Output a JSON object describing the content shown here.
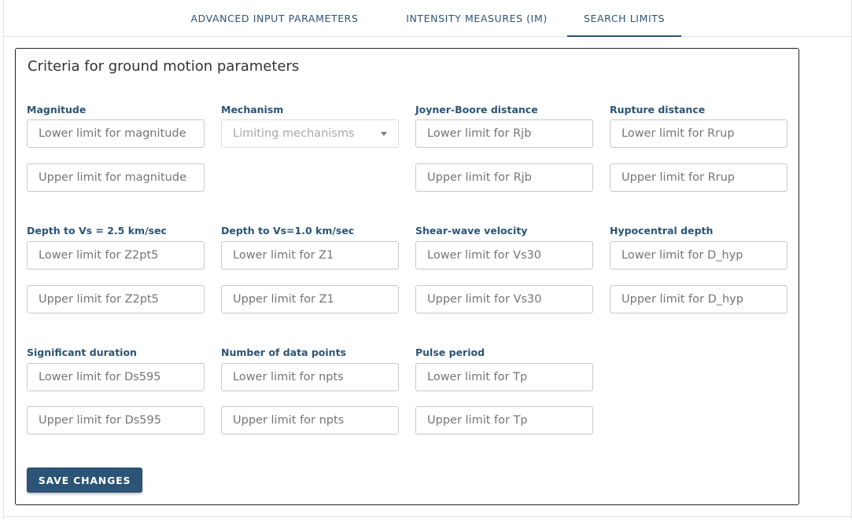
{
  "tabs": [
    {
      "label": "ADVANCED INPUT PARAMETERS",
      "active": false
    },
    {
      "label": "INTENSITY MEASURES (IM)",
      "active": false
    },
    {
      "label": "SEARCH LIMITS",
      "active": true
    }
  ],
  "card": {
    "title": "Criteria for ground motion parameters"
  },
  "fields": {
    "magnitude": {
      "label": "Magnitude",
      "lower": "Lower limit for magnitude",
      "upper": "Upper limit for magnitude"
    },
    "mechanism": {
      "label": "Mechanism",
      "placeholder": "Limiting mechanisms"
    },
    "rjb": {
      "label": "Joyner-Boore distance",
      "lower": "Lower limit for Rjb",
      "upper": "Upper limit for Rjb"
    },
    "rrup": {
      "label": "Rupture distance",
      "lower": "Lower limit for Rrup",
      "upper": "Upper limit for Rrup"
    },
    "z2pt5": {
      "label": "Depth to Vs = 2.5 km/sec",
      "lower": "Lower limit for Z2pt5",
      "upper": "Upper limit for Z2pt5"
    },
    "z1": {
      "label": "Depth to Vs=1.0 km/sec",
      "lower": "Lower limit for Z1",
      "upper": "Upper limit for Z1"
    },
    "vs30": {
      "label": "Shear-wave velocity",
      "lower": "Lower limit for Vs30",
      "upper": "Upper limit for Vs30"
    },
    "dhyp": {
      "label": "Hypocentral depth",
      "lower": "Lower limit for D_hyp",
      "upper": "Upper limit for D_hyp"
    },
    "ds595": {
      "label": "Significant duration",
      "lower": "Lower limit for Ds595",
      "upper": "Upper limit for Ds595"
    },
    "npts": {
      "label": "Number of data points",
      "lower": "Lower limit for npts",
      "upper": "Upper limit for npts"
    },
    "tp": {
      "label": "Pulse period",
      "lower": "Lower limit for Tp",
      "upper": "Upper limit for Tp"
    }
  },
  "actions": {
    "save_label": "SAVE CHANGES"
  },
  "colors": {
    "accent": "#2b5476",
    "border": "#c9c9c9",
    "placeholder": "#757575"
  }
}
